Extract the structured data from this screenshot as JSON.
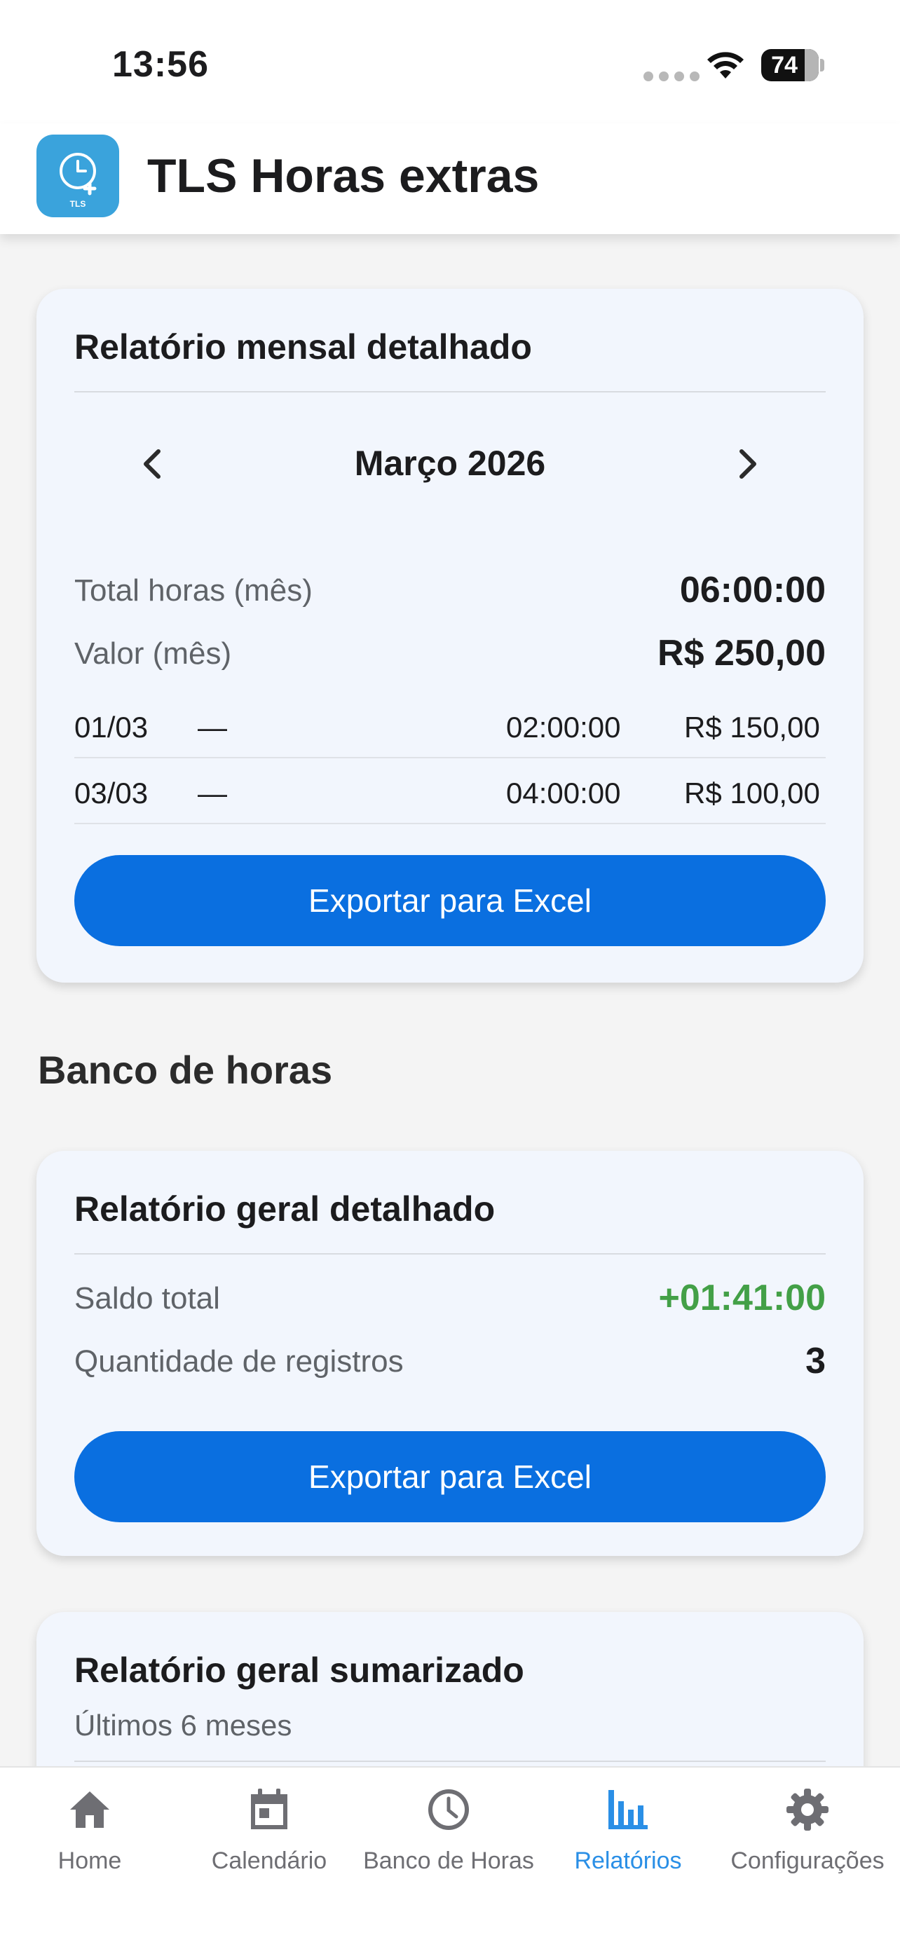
{
  "status_bar": {
    "time": "13:56",
    "battery": "74"
  },
  "app": {
    "title": "TLS Horas extras",
    "logo_text": "TLS"
  },
  "monthly_report": {
    "title": "Relatório mensal detalhado",
    "month": "Março 2026",
    "total_label": "Total horas (mês)",
    "total_value": "06:00:00",
    "value_label": "Valor (mês)",
    "value_value": "R$ 250,00",
    "entries": [
      {
        "date": "01/03",
        "dash": "—",
        "hours": "02:00:00",
        "money": "R$ 150,00"
      },
      {
        "date": "03/03",
        "dash": "—",
        "hours": "04:00:00",
        "money": "R$ 100,00"
      }
    ],
    "export_label": "Exportar para Excel"
  },
  "section": {
    "title": "Banco de horas"
  },
  "general_report": {
    "title": "Relatório geral detalhado",
    "balance_label": "Saldo total",
    "balance_value": "+01:41:00",
    "records_label": "Quantidade de registros",
    "records_value": "3",
    "export_label": "Exportar para Excel"
  },
  "summary_report": {
    "title": "Relatório geral sumarizado",
    "subtitle": "Últimos 6 meses"
  },
  "bottom_nav": [
    {
      "label": "Home",
      "icon": "home-icon",
      "active": false
    },
    {
      "label": "Calendário",
      "icon": "calendar-icon",
      "active": false
    },
    {
      "label": "Banco de Horas",
      "icon": "clock-icon",
      "active": false
    },
    {
      "label": "Relatórios",
      "icon": "bar-chart-icon",
      "active": true
    },
    {
      "label": "Configurações",
      "icon": "gear-icon",
      "active": false
    }
  ],
  "colors": {
    "primary": "#0a6fe0",
    "positive": "#43a047",
    "active_tab": "#2a8fe6",
    "logo_bg": "#3aa3dc",
    "card_bg": "#f2f6fd"
  }
}
